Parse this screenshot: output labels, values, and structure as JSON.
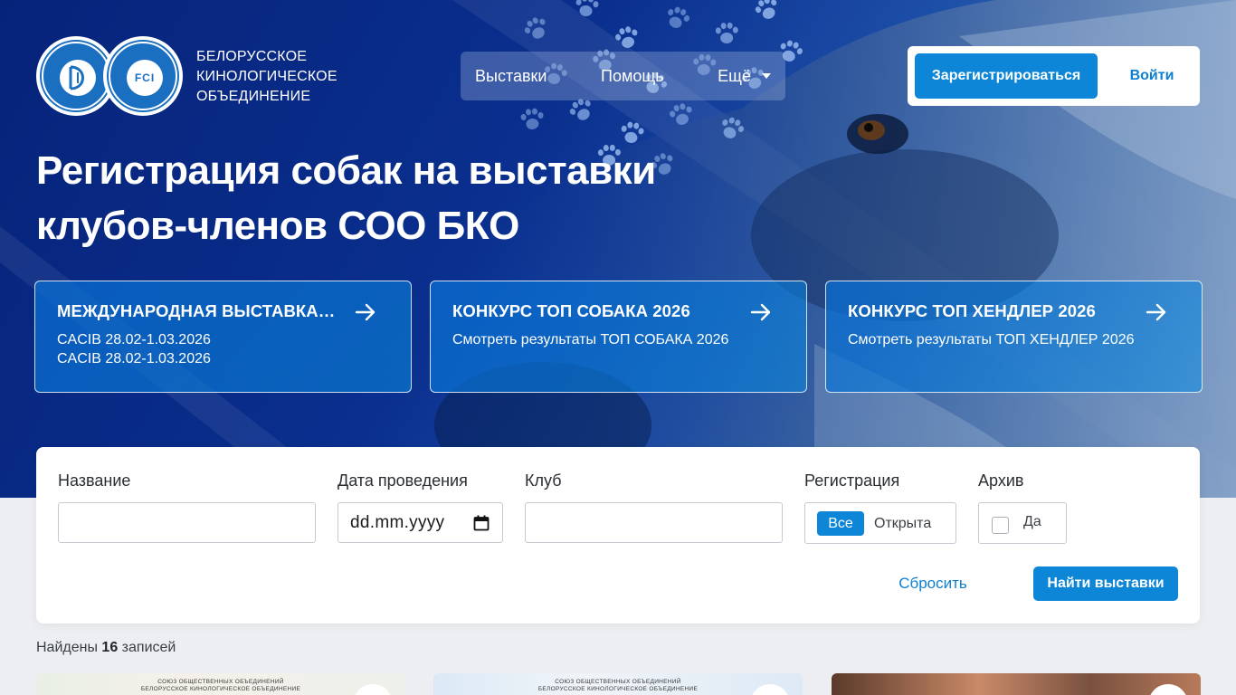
{
  "brand": {
    "seal_left_text": "",
    "seal_right_text": "FCI",
    "lines": [
      "БЕЛОРУССКОЕ",
      "КИНОЛОГИЧЕСКОЕ",
      "ОБЪЕДИНЕНИЕ"
    ]
  },
  "nav": {
    "items": [
      {
        "label": "Выставки"
      },
      {
        "label": "Помощь"
      },
      {
        "label": "Ещё"
      }
    ]
  },
  "auth": {
    "register_label": "Зарегистрироваться",
    "login_label": "Войти"
  },
  "hero": {
    "title": "Регистрация собак на выставки клубов-членов СОО БКО"
  },
  "cards": [
    {
      "title": "МЕЖДУНАРОДНАЯ ВЫСТАВКА СОБАК",
      "lines": [
        "CACIB 28.02-1.03.2026",
        "CACIB 28.02-1.03.2026"
      ]
    },
    {
      "title": "КОНКУРС ТОП СОБАКА 2026",
      "lines": [
        "Смотреть результаты ТОП СОБАКА 2026"
      ]
    },
    {
      "title": "КОНКУРС ТОП ХЕНДЛЕР 2026",
      "lines": [
        "Смотреть результаты ТОП ХЕНДЛЕР 2026"
      ]
    }
  ],
  "filter": {
    "name_label": "Название",
    "name_value": "",
    "date_label": "Дата проведения",
    "date_value": "dd.mm.yyyy",
    "club_label": "Клуб",
    "club_value": "",
    "registration_label": "Регистрация",
    "registration_options": [
      "Все",
      "Открыта"
    ],
    "registration_selected": "Все",
    "archive_label": "Архив",
    "archive_checkbox_label": "Да",
    "archive_checked": false,
    "reset_label": "Сбросить",
    "find_label": "Найти выставки"
  },
  "results": {
    "found_prefix": "Найдены",
    "count": "16",
    "found_suffix": "записей",
    "thumbs": [
      {
        "cap1": "СОЮЗ ОБЩЕСТВЕННЫХ ОБЪЕДИНЕНИЙ",
        "cap2": "БЕЛОРУССКОЕ КИНОЛОГИЧЕСКОЕ ОБЪЕДИНЕНИЕ"
      },
      {
        "cap1": "СОЮЗ ОБЩЕСТВЕННЫХ ОБЪЕДИНЕНИЙ",
        "cap2": "БЕЛОРУССКОЕ КИНОЛОГИЧЕСКОЕ ОБЪЕДИНЕНИЕ"
      },
      {
        "cap1": "",
        "cap2": ""
      }
    ]
  },
  "colors": {
    "primary": "#0d86d8",
    "hero_dark": "#06237a",
    "link": "#0d7fd0"
  },
  "icons": {
    "card_arrow": "arrow-right-icon",
    "nav_caret": "chevron-down-icon",
    "date_picker": "calendar-icon"
  }
}
